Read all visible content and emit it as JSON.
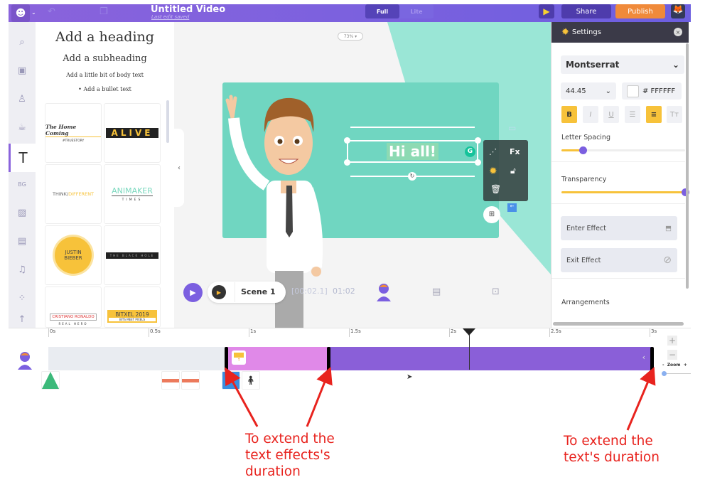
{
  "topbar": {
    "title": "Untitled Video",
    "subtitle": "Last edit saved",
    "mode_options": [
      "Full",
      "Lite"
    ],
    "mode_selected": "Full",
    "share": "Share",
    "publish": "Publish",
    "icons": [
      "logo-icon",
      "undo-icon",
      "copy-icon",
      "play-icon"
    ]
  },
  "sidebar": {
    "items": [
      "search",
      "video-props",
      "character",
      "cup-props",
      "text",
      "bg",
      "image",
      "video",
      "music",
      "effects",
      "up-arrow"
    ],
    "active": "text"
  },
  "text_panel": {
    "heading": "Add a heading",
    "subheading": "Add a subheading",
    "body": "Add a little bit of body text",
    "bullet": "Add a bullet text",
    "cards": [
      {
        "title": "The Home Coming",
        "sub": "#TRUESTORY"
      },
      {
        "title": "ALIVE"
      },
      {
        "title": "THINK/",
        "title2": "DIFFERENT"
      },
      {
        "title": "ANIMAKER",
        "sub": "TIMES"
      },
      {
        "title": "JUSTIN",
        "title2": "BIEBER"
      },
      {
        "title": "THE BLACK HOLE"
      },
      {
        "title": "CRISTIANO RONALDO",
        "sub": "REAL HERO"
      },
      {
        "title": "BITXEL 2019",
        "sub": "BITS MEET PIXELS"
      }
    ]
  },
  "canvas": {
    "zoom": "73%",
    "text": "Hi all!",
    "tools": {
      "fx": "Fx"
    },
    "scene_label": "Scene 1",
    "current_time": "[00:02.1]",
    "total_time": "01:02"
  },
  "settings": {
    "title": "Settings",
    "font": "Montserrat",
    "size": "44.45",
    "color": "# FFFFFF",
    "format": {
      "bold": true,
      "italic": false,
      "underline": false,
      "list": false,
      "align_center": true
    },
    "letter_spacing_label": "Letter Spacing",
    "letter_spacing": 0.17,
    "transparency_label": "Transparency",
    "transparency": 1.0,
    "enter_effect": "Enter Effect",
    "exit_effect": "Exit Effect",
    "arrangements": "Arrangements"
  },
  "timeline": {
    "ticks": [
      "0s",
      "0.5s",
      "1s",
      "1.5s",
      "2s",
      "2.5s",
      "3s"
    ],
    "playhead_s": 2.1,
    "zoom_label": "Zoom",
    "zoom_minus": "-",
    "zoom_plus": "+",
    "colors": {
      "empty": "#e9ecf1",
      "effect": "#e089e8",
      "text": "#8a5fd8"
    }
  },
  "annotations": {
    "left": [
      "To extend the",
      "text effects's",
      "duration"
    ],
    "right": [
      "To extend the",
      "text's duration"
    ],
    "color": "#e8231e"
  }
}
